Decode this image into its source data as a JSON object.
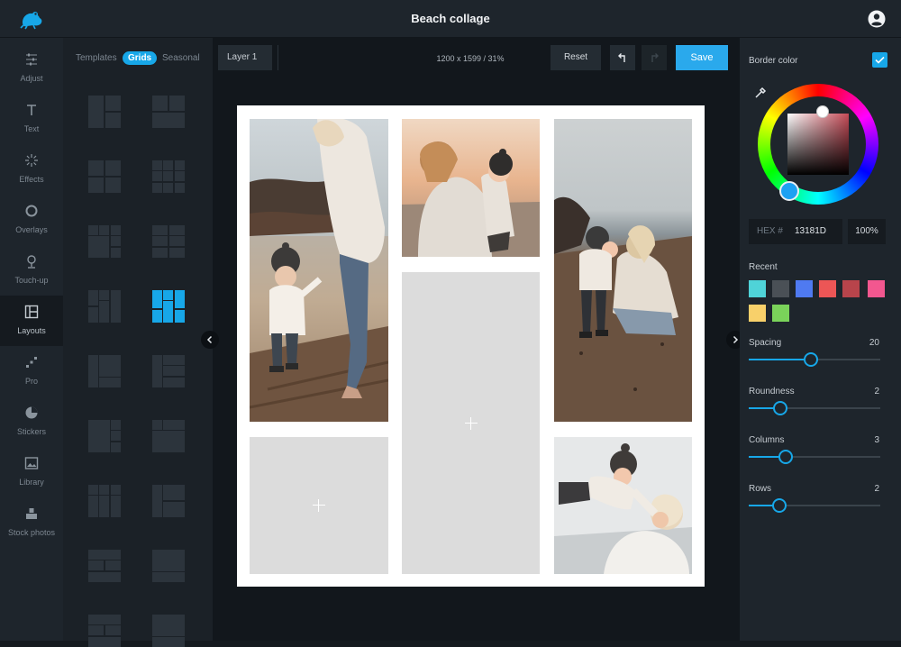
{
  "app": {
    "title": "Beach collage"
  },
  "nav": [
    {
      "label": "Adjust",
      "icon": "sliders-icon"
    },
    {
      "label": "Text",
      "icon": "text-icon"
    },
    {
      "label": "Effects",
      "icon": "sparkle-icon"
    },
    {
      "label": "Overlays",
      "icon": "ring-icon"
    },
    {
      "label": "Touch-up",
      "icon": "face-icon"
    },
    {
      "label": "Layouts",
      "icon": "layout-icon",
      "active": true
    },
    {
      "label": "Pro",
      "icon": "pro-icon"
    },
    {
      "label": "Stickers",
      "icon": "sticker-icon"
    },
    {
      "label": "Library",
      "icon": "image-icon"
    },
    {
      "label": "Stock photos",
      "icon": "stock-icon"
    }
  ],
  "tabs": [
    "Templates",
    "Grids",
    "Seasonal"
  ],
  "active_tab": "Grids",
  "toolbar": {
    "layer": "Layer 1",
    "dimensions": "1200 x 1599 / 31%",
    "reset": "Reset",
    "save": "Save"
  },
  "colors": {
    "accent": "#17a7e8",
    "border_hex_display": "13181D"
  },
  "right": {
    "border_color_label": "Border color",
    "border_color_checked": true,
    "hex_label": "HEX #",
    "hex_value": "13181D",
    "opacity": "100%",
    "recent_label": "Recent",
    "recent_colors": [
      "#4fd3d8",
      "#4a5056",
      "#4f7af1",
      "#ec5656",
      "#b8444b",
      "#f2578f",
      "#f8d06a",
      "#7ad35a"
    ],
    "sliders": [
      {
        "label": "Spacing",
        "value": "20",
        "fraction": 0.47
      },
      {
        "label": "Roundness",
        "value": "2",
        "fraction": 0.24
      },
      {
        "label": "Columns",
        "value": "3",
        "fraction": 0.28
      },
      {
        "label": "Rows",
        "value": "2",
        "fraction": 0.23
      }
    ]
  }
}
